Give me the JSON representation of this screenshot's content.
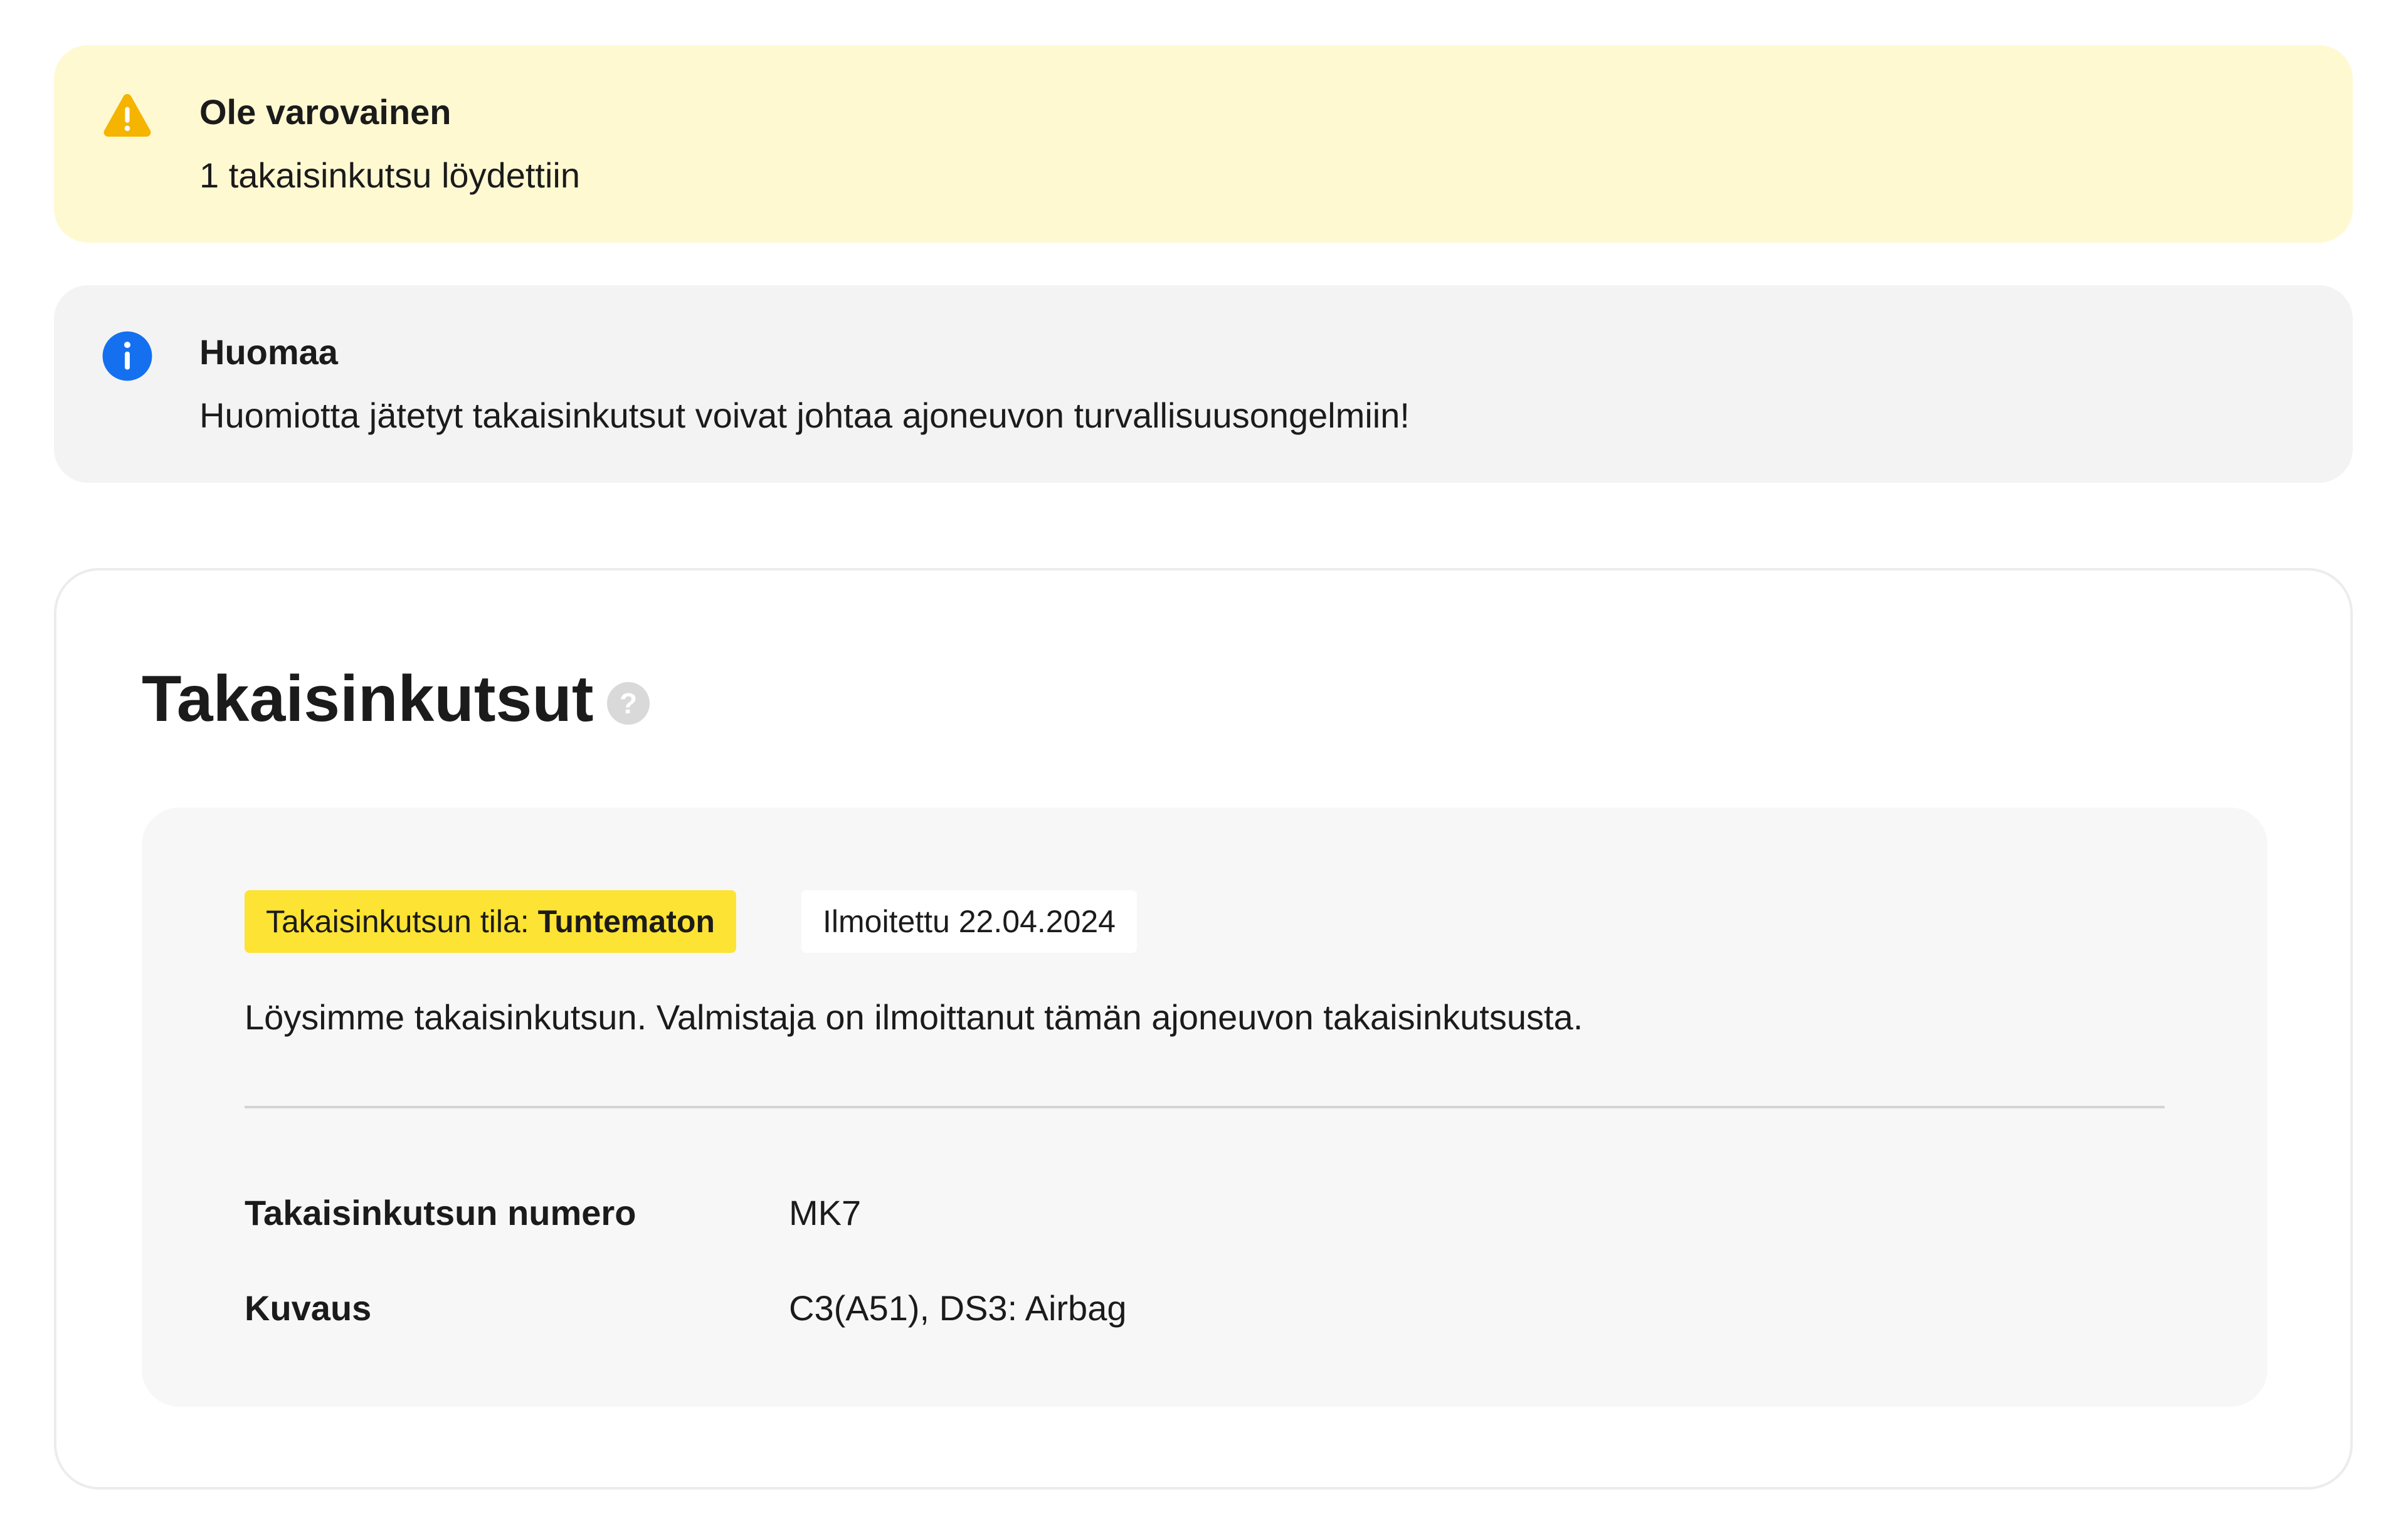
{
  "alerts": {
    "warning": {
      "icon": "warning-triangle-icon",
      "title": "Ole varovainen",
      "text": "1 takaisinkutsu löydettiin",
      "background": "#fff9d2",
      "icon_color": "#f5b400"
    },
    "info": {
      "icon": "info-circle-icon",
      "title": "Huomaa",
      "text": "Huomiotta jätetyt takaisinkutsut voivat johtaa ajoneuvon turvallisuusongelmiin!",
      "background": "#f3f3f3",
      "icon_color": "#1570ef"
    }
  },
  "recalls": {
    "title": "Takaisinkutsut",
    "help_icon": "question-circle-icon",
    "help_glyph": "?",
    "item": {
      "status_label": "Takaisinkutsun tila:",
      "status_value": "Tuntematon",
      "status_color": "#fde334",
      "reported": "Ilmoitettu 22.04.2024",
      "description": "Löysimme takaisinkutsun. Valmistaja on ilmoittanut tämän ajoneuvon takaisinkutsusta.",
      "details": [
        {
          "label": "Takaisinkutsun numero",
          "value": "MK7"
        },
        {
          "label": "Kuvaus",
          "value": "C3(A51), DS3: Airbag"
        }
      ]
    }
  }
}
